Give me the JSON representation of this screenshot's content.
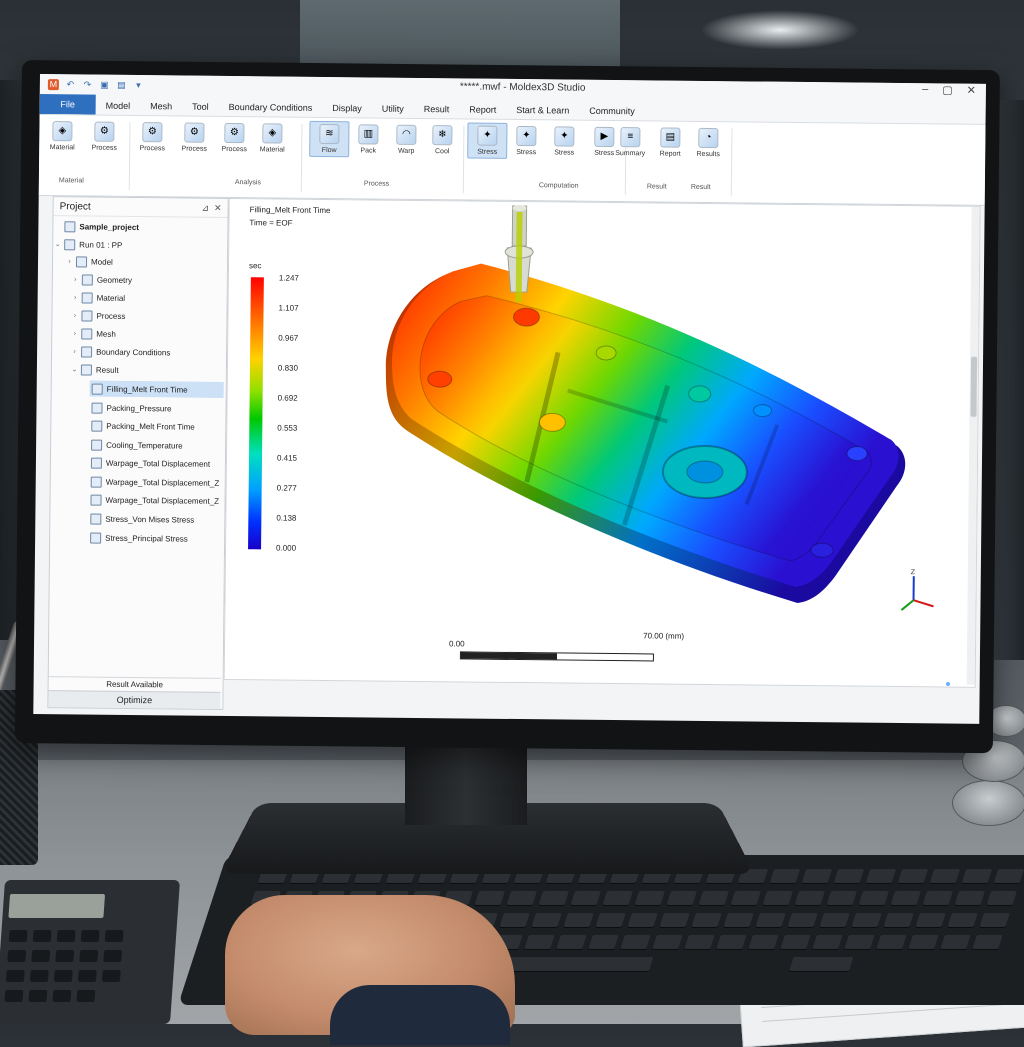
{
  "app": {
    "window_title": "*****.mwf - Moldex3D Studio",
    "file_tab": "File",
    "menu": [
      "Model",
      "Mesh",
      "Tool",
      "Boundary Conditions",
      "Display",
      "Utility",
      "Result",
      "Report",
      "Start & Learn",
      "Community"
    ]
  },
  "ribbon": {
    "buttons": [
      {
        "label": "Material",
        "icon": "material-icon"
      },
      {
        "label": "Process",
        "icon": "process-icon"
      },
      {
        "label": "Process",
        "icon": "process-wizard-icon"
      },
      {
        "label": "Process",
        "icon": "process-settings-icon"
      },
      {
        "label": "Material",
        "icon": "material-wizard-icon"
      },
      {
        "label": "Flow",
        "icon": "flow-icon"
      },
      {
        "label": "Pack",
        "icon": "pack-icon"
      },
      {
        "label": "Warp",
        "icon": "warp-icon"
      },
      {
        "label": "Cool",
        "icon": "cool-icon"
      },
      {
        "label": "Stress",
        "icon": "stress-icon"
      },
      {
        "label": "Stress",
        "icon": "stress-result-icon"
      },
      {
        "label": "Summary",
        "icon": "summary-icon"
      },
      {
        "label": "Report",
        "icon": "report-icon"
      },
      {
        "label": "Results",
        "icon": "results-icon"
      }
    ],
    "groups": [
      "Material",
      "Analysis",
      "Process",
      "Computation",
      "Result",
      "Result"
    ]
  },
  "project": {
    "header": "Project",
    "root": "Sample_project",
    "run": "Run 01 : PP",
    "model": "Model",
    "children": [
      "Geometry",
      "Material",
      "Process",
      "Mesh",
      "Boundary Conditions",
      "Result"
    ],
    "results": [
      "Filling_Melt Front Time",
      "Packing_Pressure",
      "Packing_Melt Front Time",
      "Cooling_Temperature",
      "Warpage_Total Displacement",
      "Warpage_Total Displacement_Z",
      "Warpage_Total Displacement_Z",
      "Stress_Von Mises Stress",
      "Stress_Principal Stress"
    ],
    "status": "Result Available",
    "footer": "Optimize"
  },
  "viewport": {
    "result_title": "Filling_Melt Front Time",
    "time_label": "Time = EOF",
    "colorbar_unit": "sec",
    "colorbar_ticks": [
      "1.247",
      "1.107",
      "0.967",
      "0.830",
      "0.692",
      "0.553",
      "0.415",
      "0.277",
      "0.138",
      "0.000"
    ],
    "scale_left": "0.00",
    "scale_right": "70.00 (mm)"
  },
  "colors": {
    "accent": "#2f6fc0",
    "selection": "#cce0f6"
  }
}
